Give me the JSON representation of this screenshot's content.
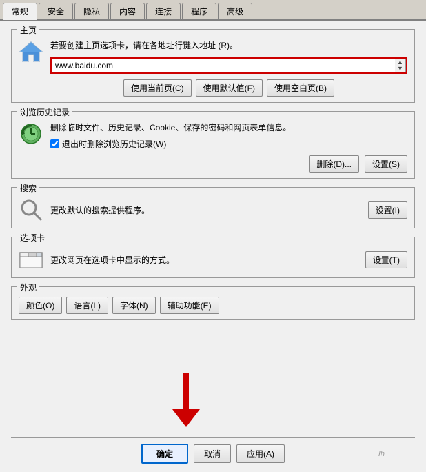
{
  "tabs": [
    {
      "label": "常规",
      "active": true
    },
    {
      "label": "安全",
      "active": false
    },
    {
      "label": "隐私",
      "active": false
    },
    {
      "label": "内容",
      "active": false
    },
    {
      "label": "连接",
      "active": false
    },
    {
      "label": "程序",
      "active": false
    },
    {
      "label": "高级",
      "active": false
    }
  ],
  "homepage": {
    "title": "主页",
    "description": "若要创建主页选项卡，请在各地址行键入地址 (R)。",
    "url_value": "www.baidu.com",
    "btn_current": "使用当前页(C)",
    "btn_default": "使用默认值(F)",
    "btn_blank": "使用空白页(B)"
  },
  "history": {
    "title": "浏览历史记录",
    "description": "删除临时文件、历史记录、Cookie、保存的密码和网页表单信息。",
    "checkbox_label": "退出时删除浏览历史记录(W)",
    "checkbox_checked": true,
    "btn_delete": "删除(D)...",
    "btn_settings": "设置(S)"
  },
  "search": {
    "title": "搜索",
    "description": "更改默认的搜索提供程序。",
    "btn_settings": "设置(I)"
  },
  "tabs_section": {
    "title": "选项卡",
    "description": "更改网页在选项卡中显示的方式。",
    "btn_settings": "设置(T)"
  },
  "appearance": {
    "title": "外观",
    "btn_color": "颜色(O)",
    "btn_language": "语言(L)",
    "btn_font": "字体(N)",
    "btn_accessibility": "辅助功能(E)"
  },
  "bottom": {
    "btn_ok": "确定",
    "btn_cancel": "取消",
    "btn_apply": "应用(A)",
    "watermark": "Ih"
  }
}
